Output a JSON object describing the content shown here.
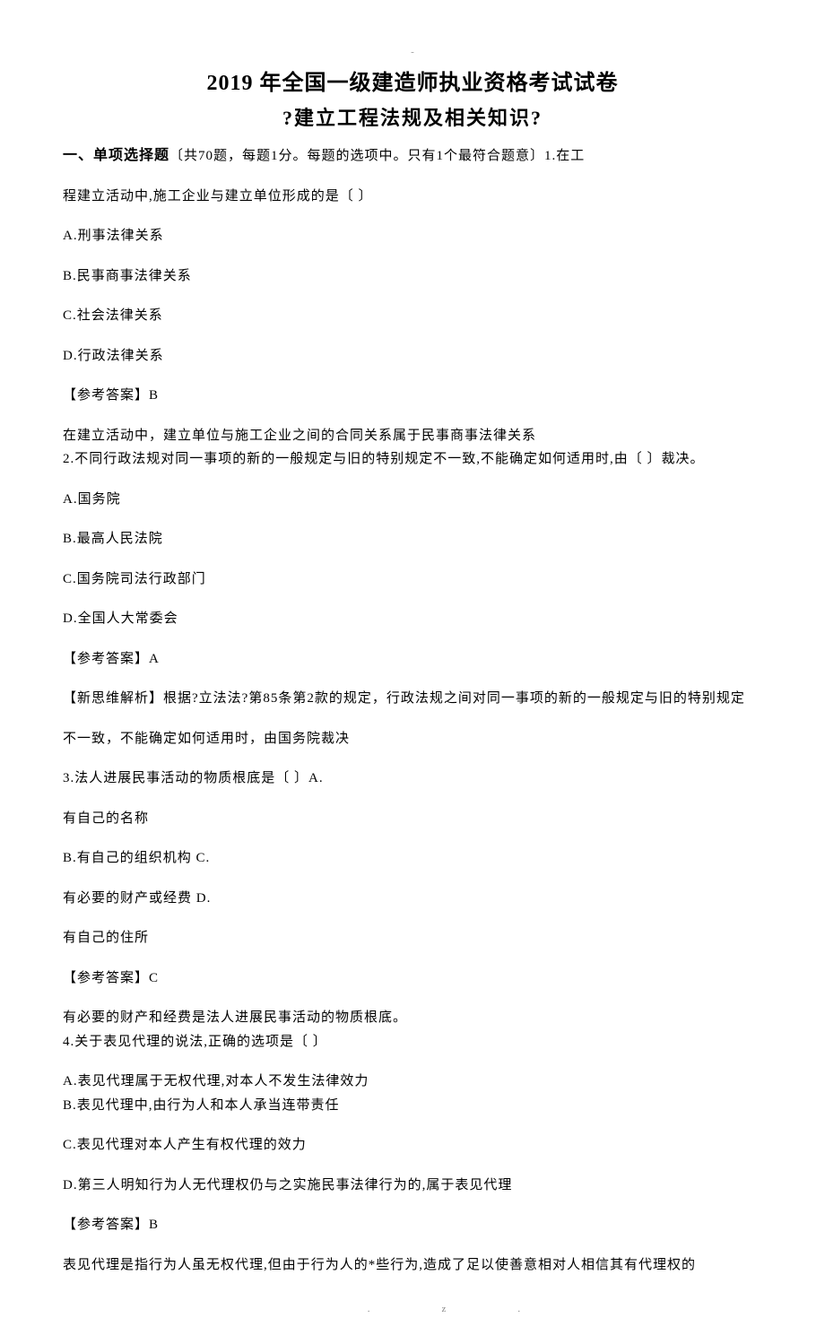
{
  "header_mark": "-",
  "title": "2019 年全国一级建造师执业资格考试试卷",
  "subtitle": "?建立工程法规及相关知识?",
  "section_heading_bold": "一、单项选择题",
  "section_heading_rest": "〔共70题，每题1分。每题的选项中。只有1个最符合题意〕1.在工",
  "q1": {
    "stem2": "程建立活动中,施工企业与建立单位形成的是〔 〕",
    "a": "A.刑事法律关系",
    "b": "B.民事商事法律关系",
    "c": "C.社会法律关系",
    "d": "D.行政法律关系",
    "ans": "【参考答案】B",
    "exp": "在建立活动中，建立单位与施工企业之间的合同关系属于民事商事法律关系"
  },
  "q2": {
    "stem": "2.不同行政法规对同一事项的新的一般规定与旧的特别规定不一致,不能确定如何适用时,由〔 〕裁决。",
    "a": "A.国务院",
    "b": "B.最高人民法院",
    "c": "C.国务院司法行政部门",
    "d": "D.全国人大常委会",
    "ans": "【参考答案】A",
    "exp1": "【新思维解析】根据?立法法?第85条第2款的规定，行政法规之间对同一事项的新的一般规定与旧的特别规定",
    "exp2": "不一致，不能确定如何适用时，由国务院裁决"
  },
  "q3": {
    "stem": "3.法人进展民事活动的物质根底是〔 〕A.",
    "a": "有自己的名称",
    "b": "B.有自己的组织机构 C.",
    "c": "有必要的财产或经费 D.",
    "d": "有自己的住所",
    "ans": "【参考答案】C",
    "exp": "有必要的财产和经费是法人进展民事活动的物质根底。"
  },
  "q4": {
    "stem": "4.关于表见代理的说法,正确的选项是〔 〕",
    "a": "A.表见代理属于无权代理,对本人不发生法律效力",
    "b": "B.表见代理中,由行为人和本人承当连带责任",
    "c": "C.表见代理对本人产生有权代理的效力",
    "d": "D.第三人明知行为人无代理权仍与之实施民事法律行为的,属于表见代理",
    "ans": "【参考答案】B",
    "exp": "表见代理是指行为人虽无权代理,但由于行为人的*些行为,造成了足以使善意相对人相信其有代理权的"
  },
  "footer_dot": ".",
  "footer_z": "z."
}
